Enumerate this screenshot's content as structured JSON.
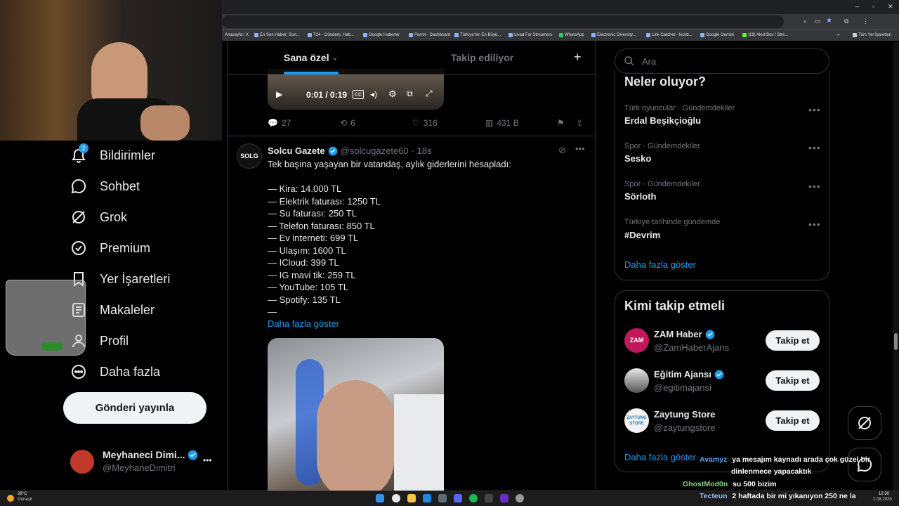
{
  "browser": {
    "bookmarks": [
      "Anasayfa / X",
      "En Son Haber: Son...",
      "T24 - Gündem, Hab...",
      "Google Haberler",
      "Parrot - Dashboard",
      "Türkiye'nin En Büyü...",
      "Livad For Streamers",
      "WhatsApp",
      "Electronic Diversity...",
      "Link Catcher - kickb...",
      "Google Gemini",
      "(19) Alert Box / Stre...",
      "»",
      "Tüm Yer İşaretleri"
    ]
  },
  "sidebar": {
    "notification_badge": "2",
    "items": [
      {
        "label": "Bildirimler",
        "icon": "bell-icon"
      },
      {
        "label": "Sohbet",
        "icon": "chat-icon"
      },
      {
        "label": "Grok",
        "icon": "grok-icon"
      },
      {
        "label": "Premium",
        "icon": "verified-icon"
      },
      {
        "label": "Yer İşaretleri",
        "icon": "bookmark-icon"
      },
      {
        "label": "Makaleler",
        "icon": "article-icon"
      },
      {
        "label": "Profil",
        "icon": "profile-icon"
      },
      {
        "label": "Daha fazla",
        "icon": "more-circle-icon"
      }
    ],
    "post_button": "Gönderi yayınla",
    "account": {
      "name": "Meyhaneci Dimi...",
      "handle": "@MeyhaneDimitri",
      "more": "•••"
    }
  },
  "feed": {
    "tabs": [
      "Sana özel",
      "Takip ediliyor"
    ],
    "add_icon": "+",
    "video": {
      "time": "0:01 / 0:19"
    },
    "tweet1_actions": {
      "replies": "27",
      "reposts": "6",
      "likes": "316",
      "views": "431 B"
    },
    "tweet2": {
      "avatar_text": "SOLG",
      "name": "Solcu Gazete",
      "handle": "@solcugazete60",
      "time": "· 18s",
      "lines": [
        "Tek başına yaşayan bir vatandaş, aylık giderlerini hesapladı:",
        "",
        "— Kira: 14.000 TL",
        "— Elektrik faturası: 1250 TL",
        "— Su faturası: 250 TL",
        "— Telefon faturası: 850 TL",
        "— Ev interneti: 699 TL",
        "— Ulaşım: 1600 TL",
        "— ICloud: 399 TL",
        "— IG mavi tik: 259 TL",
        "— YouTube: 105 TL",
        "— Spotify: 135 TL",
        "—"
      ],
      "show_more": "Daha fazla göster"
    }
  },
  "right": {
    "search_placeholder": "Ara",
    "trends_title": "Neler oluyor?",
    "trends": [
      {
        "category": "Türk oyuncular · Gündemdekiler",
        "name": "Erdal Beşikçioğlu"
      },
      {
        "category": "Spor · Gündemdekiler",
        "name": "Sesko"
      },
      {
        "category": "Spor · Gündemdekiler",
        "name": "Sörloth"
      },
      {
        "category": "Türkiye tarihinde gündemde",
        "name": "#Devrim"
      }
    ],
    "trends_more": "Daha fazla göster",
    "follow_title": "Kimi takip etmeli",
    "suggestions": [
      {
        "name": "ZAM Haber",
        "handle": "@ZamHaberAjans",
        "button": "Takip et",
        "avatar_text": "ZAM"
      },
      {
        "name": "Eğitim Ajansı",
        "handle": "@egitimajansi",
        "button": "Takip et"
      },
      {
        "name": "Zaytung Store",
        "handle": "@zaytungstore",
        "button": "Takip et",
        "avatar_text": "ZAYTUNG STORE"
      }
    ],
    "follow_more": "Daha fazla göster"
  },
  "chat": [
    {
      "user": "Avamyz",
      "message": "ya mesajım kaynadı arada çok güzel bir",
      "user_color": "#4fa3ff"
    },
    {
      "user": "",
      "message": "dinlenmece yapacaktık",
      "user_color": "#ffffff"
    },
    {
      "user": "GhostMod0n",
      "message": "su 500 bizim",
      "user_color": "#8fd18f"
    },
    {
      "user": "Tecteun",
      "message": "2 haftada bir mi yıkanıyon 250 ne la",
      "user_color": "#a8c8ff"
    }
  ],
  "taskbar": {
    "weather_temp": "28°C",
    "weather_desc": "Güneşli",
    "time": "12:30",
    "date": "2.08.2026"
  },
  "colors": {
    "accent": "#1d9bf0",
    "bg": "#000000",
    "border": "#2f3336",
    "muted": "#71767b"
  }
}
